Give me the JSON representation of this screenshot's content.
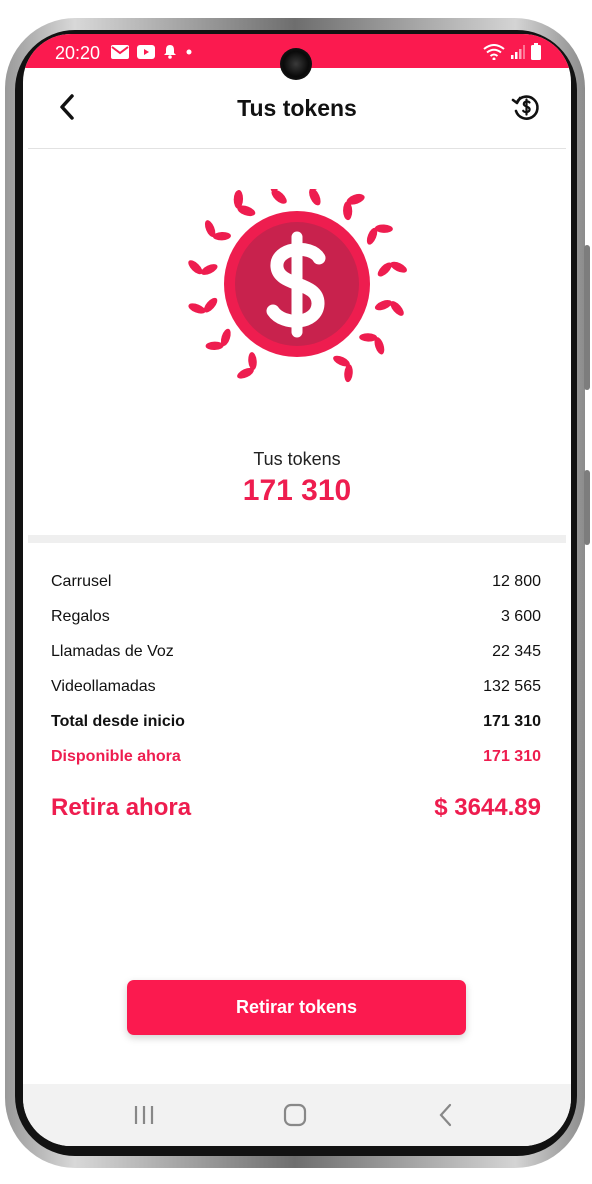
{
  "status_bar": {
    "time": "20:20",
    "color": "#fb1a4f",
    "left_icons": [
      "mail-icon",
      "youtube-icon",
      "bell-icon",
      "dot-icon"
    ],
    "right_icons": [
      "wifi-icon",
      "signal-icon",
      "battery-icon"
    ]
  },
  "header": {
    "title": "Tus tokens",
    "back_icon": "chevron-left-icon",
    "history_icon": "dollar-history-icon"
  },
  "summary": {
    "label": "Tus tokens",
    "value": "171 310",
    "emblem_icon": "dollar-laurel-icon"
  },
  "breakdown": [
    {
      "label": "Carrusel",
      "value": "12 800",
      "style": "normal"
    },
    {
      "label": "Regalos",
      "value": "3 600",
      "style": "normal"
    },
    {
      "label": "Llamadas de Voz",
      "value": "22 345",
      "style": "normal"
    },
    {
      "label": "Videollamadas",
      "value": "132 565",
      "style": "normal"
    },
    {
      "label": "Total desde inicio",
      "value": "171 310",
      "style": "bold"
    },
    {
      "label": "Disponible ahora",
      "value": "171 310",
      "style": "accent"
    }
  ],
  "withdraw": {
    "label": "Retira ahora",
    "amount": "$ 3644.89"
  },
  "cta": {
    "label": "Retirar tokens"
  },
  "nav_bar": {
    "icons": [
      "recent-apps-icon",
      "home-icon",
      "back-icon"
    ]
  },
  "colors": {
    "accent": "#ee1d4f",
    "button": "#fb1a4f"
  }
}
